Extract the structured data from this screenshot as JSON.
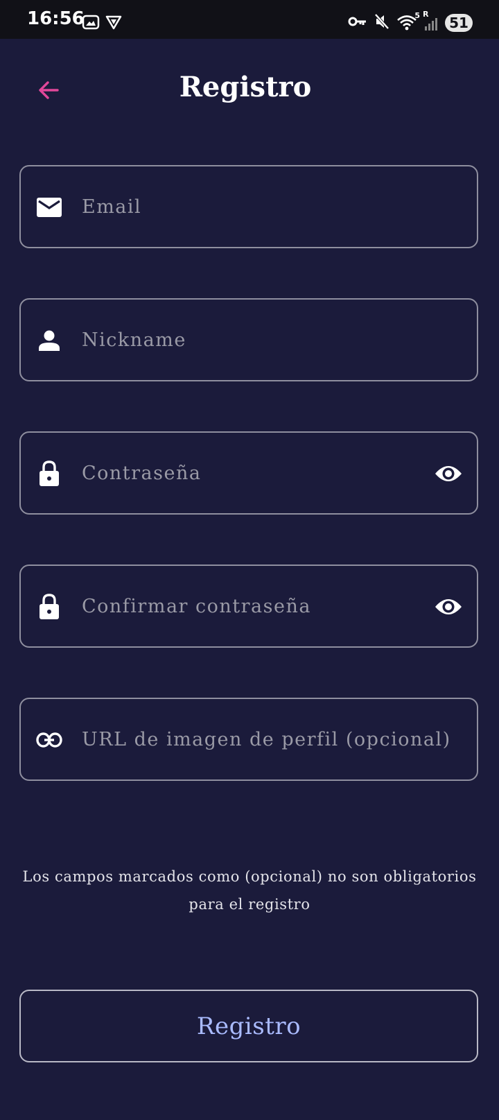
{
  "status_bar": {
    "time": "16:56",
    "battery": "51",
    "network_label": "R",
    "wifi_label": "5"
  },
  "header": {
    "title": "Registro"
  },
  "form": {
    "email": {
      "value": "",
      "placeholder": "Email",
      "icon": "email-icon"
    },
    "nickname": {
      "value": "",
      "placeholder": "Nickname",
      "icon": "person-icon"
    },
    "password": {
      "value": "",
      "placeholder": "Contraseña",
      "icon": "lock-icon"
    },
    "confirm_password": {
      "value": "",
      "placeholder": "Confirmar contraseña",
      "icon": "lock-icon"
    },
    "profile_url": {
      "value": "",
      "placeholder": "URL de imagen de perfil (opcional)",
      "icon": "link-icon"
    }
  },
  "helper_text": "Los campos marcados como (opcional) no son obligatorios para el registro",
  "submit_label": "Registro",
  "colors": {
    "background": "#1b1b3b",
    "accent_pink": "#e2479a",
    "button_text": "#aabbff",
    "field_border": "#8f8f9f"
  }
}
